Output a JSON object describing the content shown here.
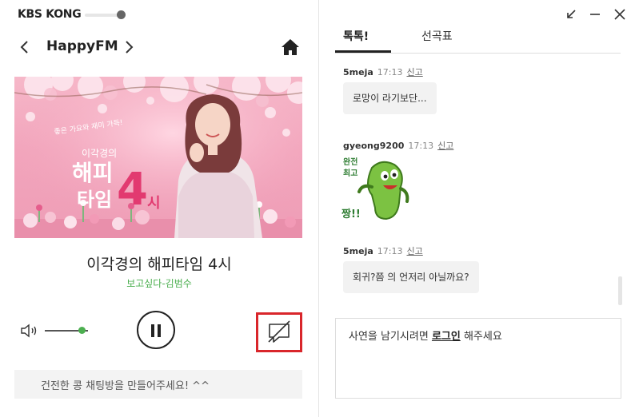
{
  "app": {
    "brand": "KBS KONG"
  },
  "player": {
    "channel": "HappyFM",
    "show_title": "이각경의 해피타임 4시",
    "song": "보고싶다-김범수",
    "volume_level": 0.85,
    "notice": "건전한 콩 채팅방을 만들어주세요! ^^",
    "banner": {
      "tagline": "좋은 가요와 재미 가득!",
      "title_small": "이각경의",
      "title_main": "해피",
      "title_sub": "타임",
      "title_num": "4",
      "title_end": "시"
    }
  },
  "tabs": [
    {
      "label": "톡톡!",
      "active": true
    },
    {
      "label": "선곡표",
      "active": false
    }
  ],
  "chat": {
    "report_label": "신고",
    "messages": [
      {
        "user": "5meja",
        "time": "17:13",
        "text": "로망이 라기보단..."
      },
      {
        "user": "gyeong9200",
        "time": "17:13",
        "emoticon": "green-bean-character-icon",
        "emoticon_text": {
          "top": "완전",
          "mid": "최고",
          "bottom": "짱!!"
        }
      },
      {
        "user": "5meja",
        "time": "17:13",
        "text": "회귀?쯤 의 언저리 아닐까요?"
      }
    ]
  },
  "input": {
    "prefix": "사연을 남기시려면 ",
    "login_link": "로그인",
    "suffix": " 해주세요"
  },
  "colors": {
    "accent_green": "#4caf50",
    "highlight_red": "#d9262b"
  }
}
